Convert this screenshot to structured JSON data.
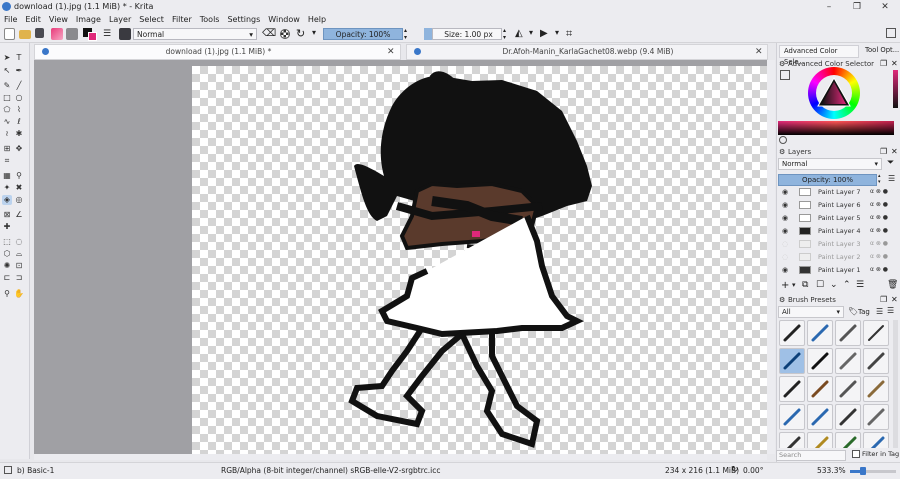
{
  "window": {
    "title": "download (1).jpg (1.1 MiB) * - Krita",
    "controls": [
      "–",
      "❐",
      "✕"
    ]
  },
  "menu": [
    "File",
    "Edit",
    "View",
    "Image",
    "Layer",
    "Select",
    "Filter",
    "Tools",
    "Settings",
    "Window",
    "Help"
  ],
  "toolbar": {
    "blend_mode": "Normal",
    "opacity": "Opacity: 100%",
    "size": "Size: 1.00 px"
  },
  "tabs": [
    {
      "label": "download (1).jpg (1.1 MiB) *",
      "close": "✕"
    },
    {
      "label": "Dr.Afoh-Manin_KarlaGachet08.webp (9.4 MiB)",
      "close": "✕"
    }
  ],
  "dock_tabs": [
    "Advanced Color Sele...",
    "Tool Opt..."
  ],
  "color_selector": {
    "title": "Advanced Color Selector"
  },
  "layers": {
    "title": "Layers",
    "blend_mode": "Normal",
    "opacity": "Opacity:  100%",
    "items": [
      {
        "name": "Paint Layer 7",
        "visible": true,
        "dim": false,
        "selected": false
      },
      {
        "name": "Paint Layer 6",
        "visible": true,
        "dim": false,
        "selected": false
      },
      {
        "name": "Paint Layer 5",
        "visible": true,
        "dim": false,
        "selected": false
      },
      {
        "name": "Paint Layer 4",
        "visible": true,
        "dim": false,
        "selected": false
      },
      {
        "name": "Paint Layer 3",
        "visible": false,
        "dim": true,
        "selected": false
      },
      {
        "name": "Paint Layer 2",
        "visible": false,
        "dim": true,
        "selected": false
      },
      {
        "name": "Paint Layer 1",
        "visible": true,
        "dim": false,
        "selected": false
      }
    ]
  },
  "brush_presets": {
    "title": "Brush Presets",
    "filter": "All",
    "tag": "Tag",
    "search_placeholder": "Search",
    "filter_in_tag": "Filter in Tag"
  },
  "status": {
    "preset": "b) Basic-1",
    "color_space": "RGB/Alpha (8-bit integer/channel)  sRGB-elle-V2-srgbtrc.icc",
    "dims": "234 x 216 (1.1 MiB)",
    "rotation": "0.00°",
    "zoom": "533.3%"
  },
  "colors": {
    "accent": "#8fb4dd",
    "skin": "#5a3a2c",
    "hair": "#111111",
    "blush": "#e0287a"
  }
}
